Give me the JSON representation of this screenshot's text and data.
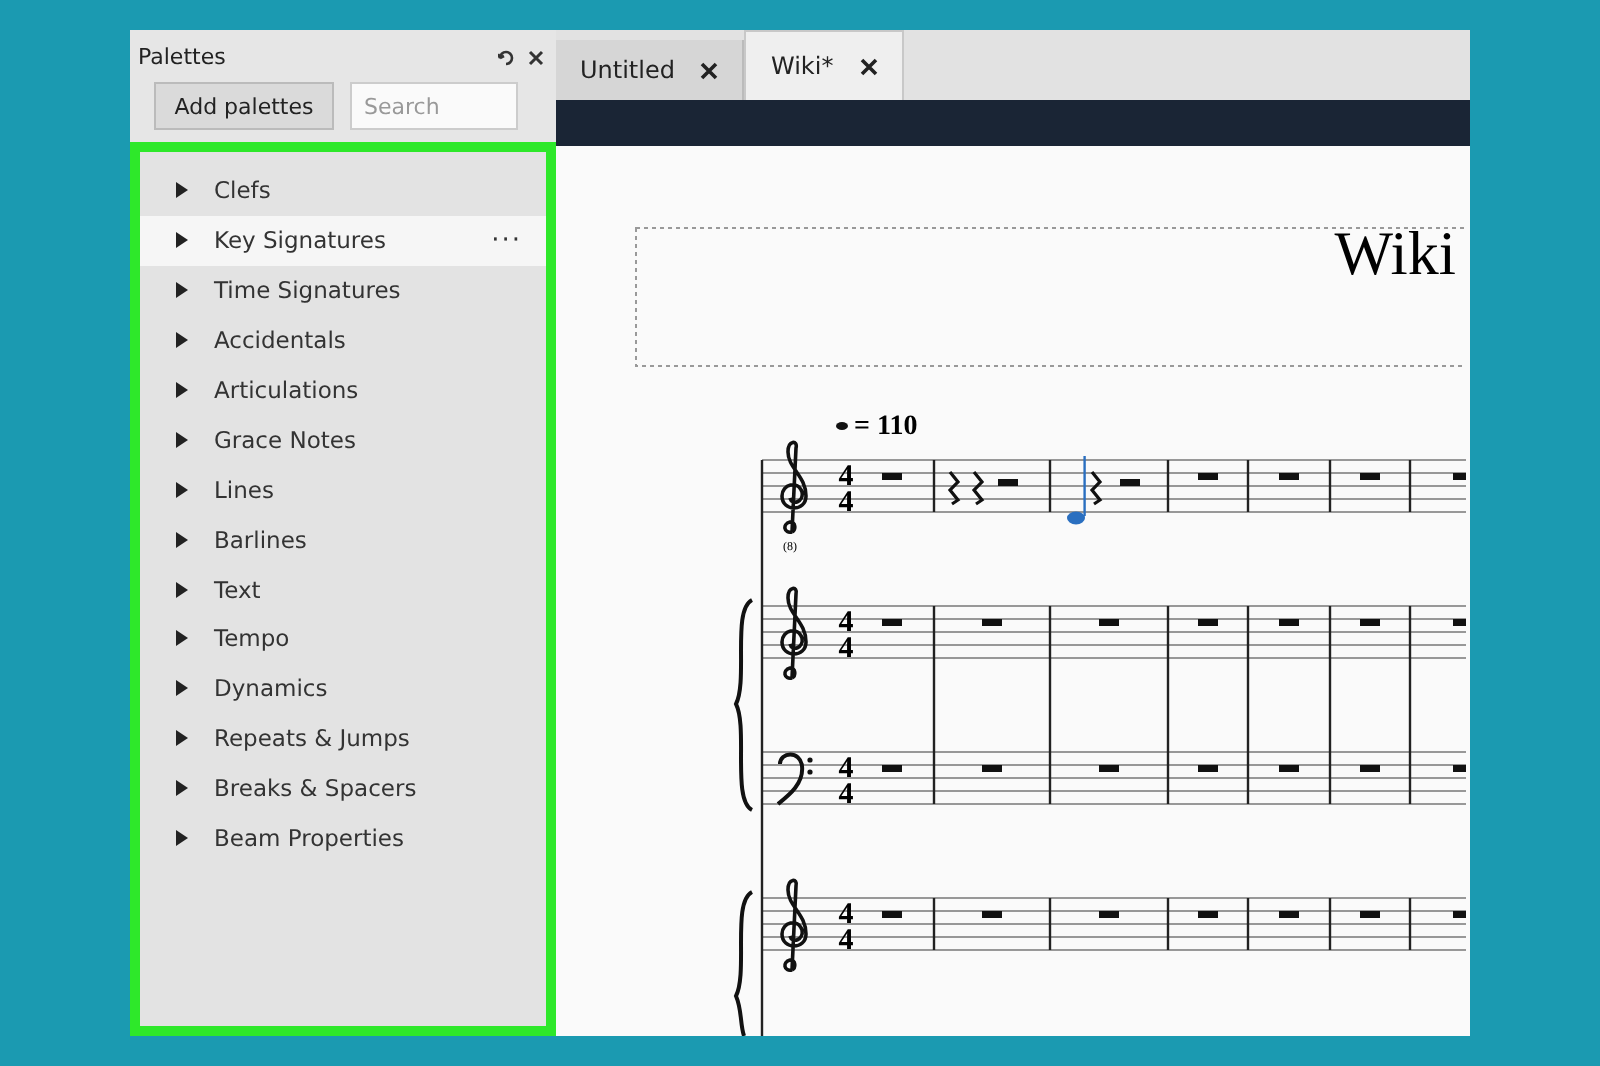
{
  "palettes": {
    "title": "Palettes",
    "add_button": "Add palettes",
    "search": {
      "placeholder": "Search"
    },
    "items": [
      {
        "label": "Clefs",
        "selected": false
      },
      {
        "label": "Key Signatures",
        "selected": true,
        "more": "···"
      },
      {
        "label": "Time Signatures",
        "selected": false
      },
      {
        "label": "Accidentals",
        "selected": false
      },
      {
        "label": "Articulations",
        "selected": false
      },
      {
        "label": "Grace Notes",
        "selected": false
      },
      {
        "label": "Lines",
        "selected": false
      },
      {
        "label": "Barlines",
        "selected": false
      },
      {
        "label": "Text",
        "selected": false
      },
      {
        "label": "Tempo",
        "selected": false
      },
      {
        "label": "Dynamics",
        "selected": false
      },
      {
        "label": "Repeats & Jumps",
        "selected": false
      },
      {
        "label": "Breaks & Spacers",
        "selected": false
      },
      {
        "label": "Beam Properties",
        "selected": false
      }
    ]
  },
  "tabs": [
    {
      "label": "Untitled",
      "selected": false
    },
    {
      "label": "Wiki*",
      "selected": true
    }
  ],
  "score": {
    "title": "Wiki",
    "tempo": "= 110",
    "staves": [
      {
        "kind": "treble",
        "clef_mark": "(8)",
        "time": [
          "4",
          "4"
        ],
        "measures": [
          {
            "kind": "whole_rest"
          },
          {
            "kind": "two_quarter_rests"
          },
          {
            "kind": "note_and_rests",
            "note_selected": true
          },
          {
            "kind": "whole_rest"
          },
          {
            "kind": "whole_rest"
          },
          {
            "kind": "whole_rest"
          },
          {
            "kind": "whole_rest"
          }
        ]
      },
      {
        "kind": "treble",
        "time": [
          "4",
          "4"
        ],
        "measures": [
          {
            "kind": "whole_rest"
          },
          {
            "kind": "whole_rest"
          },
          {
            "kind": "whole_rest"
          },
          {
            "kind": "whole_rest"
          },
          {
            "kind": "whole_rest"
          },
          {
            "kind": "whole_rest"
          },
          {
            "kind": "whole_rest"
          }
        ]
      },
      {
        "kind": "bass",
        "time": [
          "4",
          "4"
        ],
        "measures": [
          {
            "kind": "whole_rest"
          },
          {
            "kind": "whole_rest"
          },
          {
            "kind": "whole_rest"
          },
          {
            "kind": "whole_rest"
          },
          {
            "kind": "whole_rest"
          },
          {
            "kind": "whole_rest"
          },
          {
            "kind": "whole_rest"
          }
        ]
      },
      {
        "kind": "treble",
        "time": [
          "4",
          "4"
        ],
        "measures": [
          {
            "kind": "whole_rest"
          },
          {
            "kind": "whole_rest"
          },
          {
            "kind": "whole_rest"
          },
          {
            "kind": "whole_rest"
          },
          {
            "kind": "whole_rest"
          },
          {
            "kind": "whole_rest"
          },
          {
            "kind": "whole_rest"
          }
        ]
      }
    ]
  }
}
